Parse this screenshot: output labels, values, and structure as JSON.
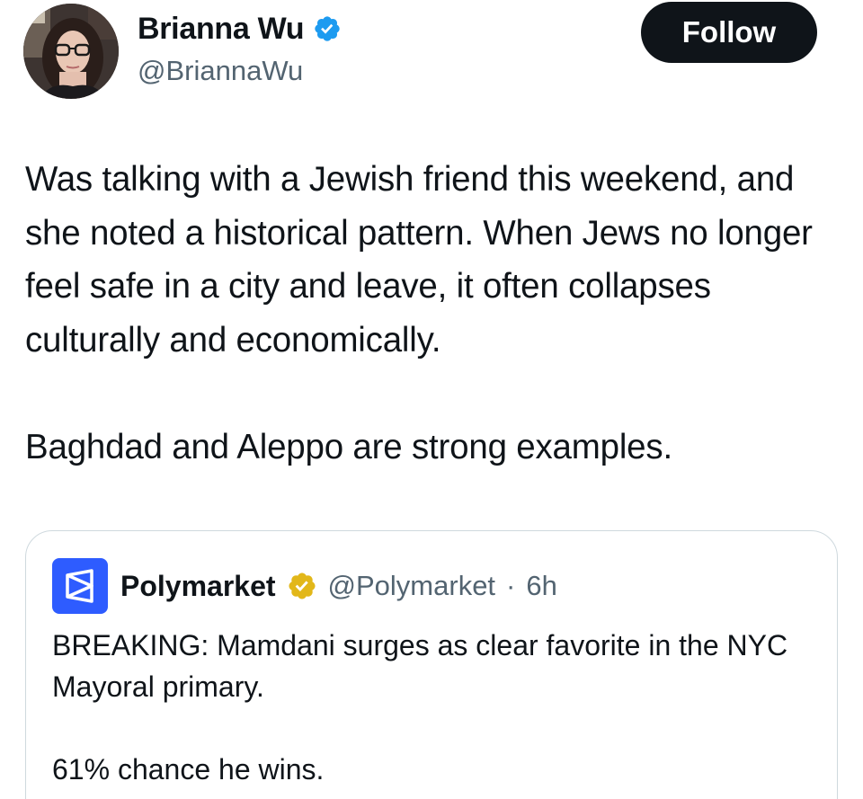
{
  "author": {
    "display_name": "Brianna Wu",
    "handle": "@BriannaWu",
    "avatar_icon": "profile-photo",
    "verified_icon": "blue-verified-badge"
  },
  "follow_button": {
    "label": "Follow"
  },
  "tweet": {
    "paragraphs": [
      "Was talking with a Jewish friend this weekend, and she noted a historical pattern. When Jews no longer feel safe in a city and leave, it often collapses culturally and economically.",
      "Baghdad and Aleppo are strong examples."
    ]
  },
  "quoted_tweet": {
    "display_name": "Polymarket",
    "handle": "@Polymarket",
    "separator": "·",
    "time": "6h",
    "logo_icon": "polymarket-logo",
    "verified_icon": "gold-verified-badge",
    "paragraphs": [
      "BREAKING: Mamdani surges as clear favorite in the NYC Mayoral primary.",
      "61% chance he wins."
    ]
  },
  "colors": {
    "text": "#0f1419",
    "secondary_text": "#536471",
    "verified_blue": "#1d9bf0",
    "verified_gold": "#e2b719",
    "follow_bg": "#0f1419",
    "polymarket_blue": "#2e5cff",
    "border": "#cfd9de"
  }
}
